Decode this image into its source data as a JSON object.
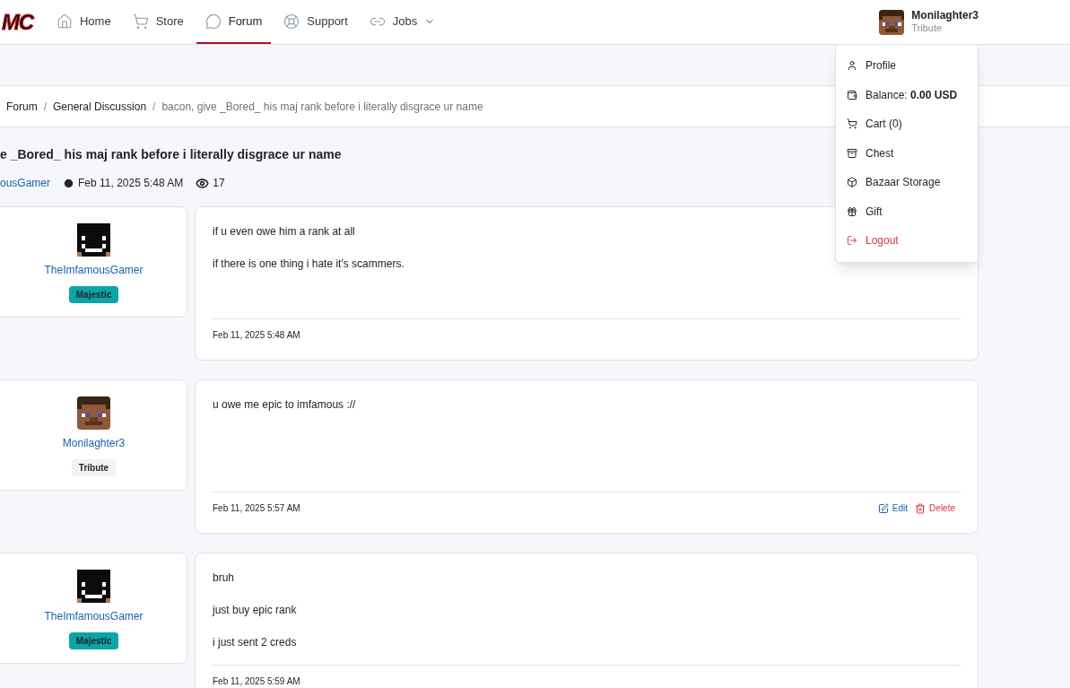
{
  "logo": "MC",
  "nav": [
    {
      "label": "Home",
      "selected": false
    },
    {
      "label": "Store",
      "selected": false
    },
    {
      "label": "Forum",
      "selected": true
    },
    {
      "label": "Support",
      "selected": false
    },
    {
      "label": "Jobs",
      "selected": false,
      "dropdown": true
    }
  ],
  "user": {
    "name": "Monilaghter3",
    "rank": "Tribute",
    "kind": "steve"
  },
  "menu": [
    {
      "label": "Profile",
      "danger": false
    },
    {
      "label": "Balance: **0.00 USD**",
      "danger": false
    },
    {
      "label": "Cart (0)",
      "danger": false
    },
    {
      "label": "Chest",
      "danger": false
    },
    {
      "label": "Bazaar Storage",
      "danger": false
    },
    {
      "label": "Gift",
      "danger": false
    },
    {
      "label": "Logout",
      "danger": true
    }
  ],
  "breadcrumb_separator": "/",
  "breadcrumb": [
    {
      "label": "Forum",
      "current": false
    },
    {
      "label": "General Discussion",
      "current": false
    },
    {
      "label": "bacon, give _Bored_ his maj rank before i literally disgrace ur name",
      "current": true
    }
  ],
  "thread": {
    "title": "e _Bored_ his maj rank before i literally disgrace ur name",
    "author": "ousGamer",
    "date": "Feb 11, 2025 5:48 AM",
    "views": "17"
  },
  "posts": [
    {
      "author": "TheImfamousGamer",
      "kind": "dark",
      "rank": {
        "label": "Majestic",
        "color": "#0aa5a5"
      },
      "lines": [
        "if u even owe him a rank at all",
        "if there is one thing i hate it's scammers."
      ],
      "date": "Feb 11, 2025 5:48 AM"
    },
    {
      "author": "Monilaghter3",
      "kind": "steve",
      "rank": {
        "label": "Tribute",
        "color": "#f1f3f5"
      },
      "lines": [
        "u owe me epic to imfamous ://"
      ],
      "date": "Feb 11, 2025 5:57 AM",
      "actions": [
        {
          "label": "Edit",
          "kind": "edit"
        },
        {
          "label": "Delete",
          "kind": "delete"
        }
      ]
    },
    {
      "author": "TheImfamousGamer",
      "kind": "dark",
      "rank": {
        "label": "Majestic",
        "color": "#0aa5a5"
      },
      "lines": [
        "bruh",
        "just buy epic rank",
        "i just sent 2 creds"
      ],
      "date": "Feb 11, 2025 5:59 AM"
    }
  ]
}
